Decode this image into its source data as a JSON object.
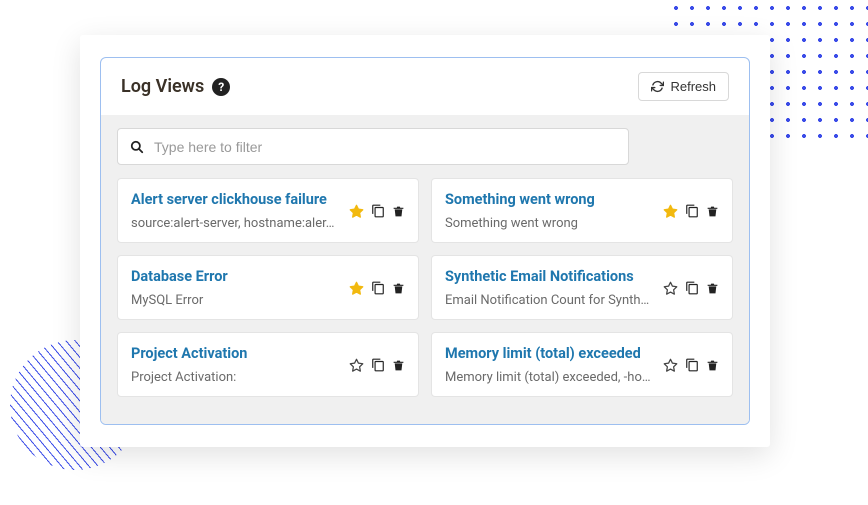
{
  "header": {
    "title": "Log Views",
    "refresh_label": "Refresh"
  },
  "filter": {
    "placeholder": "Type here to filter"
  },
  "colors": {
    "link": "#1f77ae",
    "star_active": "#f2b90f",
    "border_accent": "#9dbff0"
  },
  "views": [
    {
      "title": "Alert server clickhouse failure",
      "desc": "source:alert-server, hostname:aler…",
      "starred": true
    },
    {
      "title": "Something went wrong",
      "desc": "Something went wrong",
      "starred": true
    },
    {
      "title": "Database Error",
      "desc": "MySQL Error",
      "starred": true
    },
    {
      "title": "Synthetic Email Notifications",
      "desc": "Email Notification Count for Synth…",
      "starred": false
    },
    {
      "title": "Project Activation",
      "desc": "Project Activation:",
      "starred": false
    },
    {
      "title": "Memory limit (total) exceeded",
      "desc": "Memory limit (total) exceeded, -ho…",
      "starred": false
    }
  ]
}
